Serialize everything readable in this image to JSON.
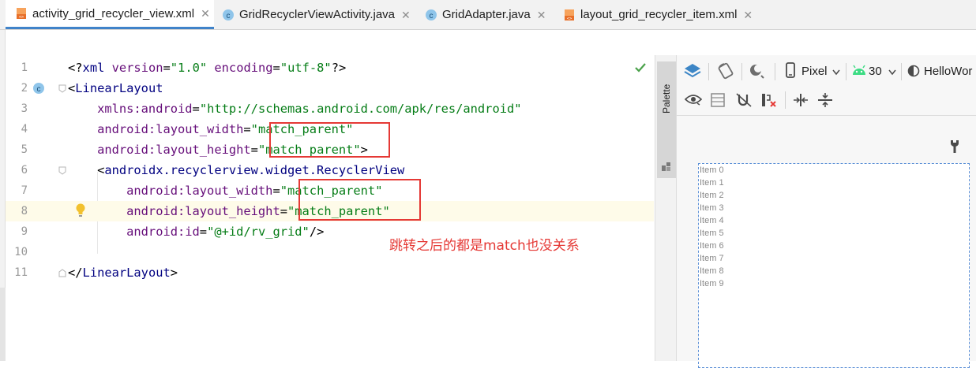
{
  "tabs": [
    {
      "label": "activity_grid_recycler_view.xml",
      "icon": "xml-file-icon",
      "active": true
    },
    {
      "label": "GridRecyclerViewActivity.java",
      "icon": "java-class-icon",
      "active": false
    },
    {
      "label": "GridAdapter.java",
      "icon": "java-class-icon",
      "active": false
    },
    {
      "label": "layout_grid_recycler_item.xml",
      "icon": "xml-file-icon",
      "active": false
    }
  ],
  "close_glyph": "✕",
  "editor": {
    "lines": [
      {
        "no": "1",
        "tokens": [
          [
            "pun",
            "<?"
          ],
          [
            "tag",
            "xml "
          ],
          [
            "attr",
            "version"
          ],
          [
            "pun",
            "="
          ],
          [
            "str",
            "\"1.0\" "
          ],
          [
            "attr",
            "encoding"
          ],
          [
            "pun",
            "="
          ],
          [
            "str",
            "\"utf-8\""
          ],
          [
            "pun",
            "?>"
          ]
        ]
      },
      {
        "no": "2",
        "tokens": [
          [
            "pun",
            "<"
          ],
          [
            "tag",
            "LinearLayout"
          ]
        ]
      },
      {
        "no": "3",
        "tokens": [
          [
            "ns",
            "    xmlns:android"
          ],
          [
            "pun",
            "="
          ],
          [
            "str",
            "\"http://schemas.android.com/apk/res/android\""
          ]
        ]
      },
      {
        "no": "4",
        "tokens": [
          [
            "ns",
            "    android:layout_width"
          ],
          [
            "pun",
            "="
          ],
          [
            "str",
            "\"match_parent\""
          ]
        ]
      },
      {
        "no": "5",
        "tokens": [
          [
            "ns",
            "    android:layout_height"
          ],
          [
            "pun",
            "="
          ],
          [
            "str",
            "\"match_parent\""
          ],
          [
            "pun",
            ">"
          ]
        ]
      },
      {
        "no": "6",
        "tokens": [
          [
            "pun",
            "    <"
          ],
          [
            "tag",
            "androidx.recyclerview.widget.RecyclerView"
          ]
        ]
      },
      {
        "no": "7",
        "tokens": [
          [
            "ns",
            "        android:layout_width"
          ],
          [
            "pun",
            "="
          ],
          [
            "str",
            "\"match_parent\""
          ]
        ]
      },
      {
        "no": "8",
        "tokens": [
          [
            "ns",
            "        android:layout_height"
          ],
          [
            "pun",
            "="
          ],
          [
            "str",
            "\"match_parent\""
          ]
        ]
      },
      {
        "no": "9",
        "tokens": [
          [
            "ns",
            "        android:id"
          ],
          [
            "pun",
            "="
          ],
          [
            "str",
            "\"@+id/rv_grid\""
          ],
          [
            "pun",
            "/>"
          ]
        ]
      },
      {
        "no": "10",
        "tokens": []
      },
      {
        "no": "11",
        "tokens": [
          [
            "pun",
            "</"
          ],
          [
            "tag",
            "LinearLayout"
          ],
          [
            "pun",
            ">"
          ]
        ]
      }
    ],
    "annotation": "跳转之后的都是match也没关系"
  },
  "palette": {
    "label": "Palette"
  },
  "design_toolbar": {
    "device": "Pixel",
    "api_level": "30",
    "theme": "HelloWor"
  },
  "preview": {
    "items": [
      "Item 0",
      "Item 1",
      "Item 2",
      "Item 3",
      "Item 4",
      "Item 5",
      "Item 6",
      "Item 7",
      "Item 8",
      "Item 9"
    ]
  },
  "colors": {
    "accent": "#4083c9",
    "annotation_red": "#e53935",
    "string_green": "#067d17",
    "tag_navy": "#000080",
    "attr_purple": "#660e7a"
  }
}
